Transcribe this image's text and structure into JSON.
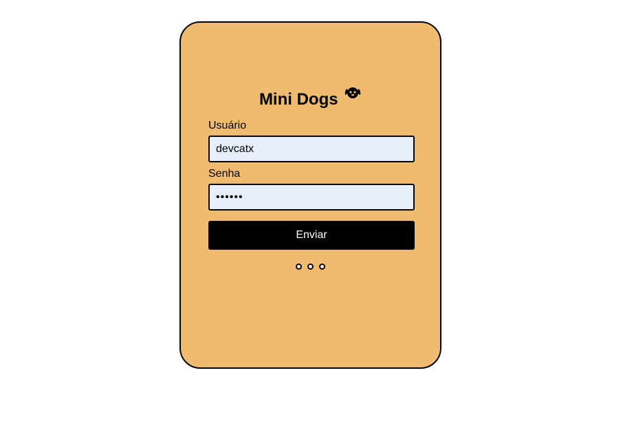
{
  "login": {
    "title": "Mini Dogs",
    "logo_icon": "dog-icon",
    "username_label": "Usuário",
    "username_value": "devcatx",
    "password_label": "Senha",
    "password_value": "••••••",
    "submit_label": "Enviar",
    "loading_indicator": "three-dots"
  },
  "colors": {
    "card_background": "#efbb6e",
    "input_background": "#e8effc",
    "button_background": "#000000",
    "button_text": "#ffffff"
  }
}
